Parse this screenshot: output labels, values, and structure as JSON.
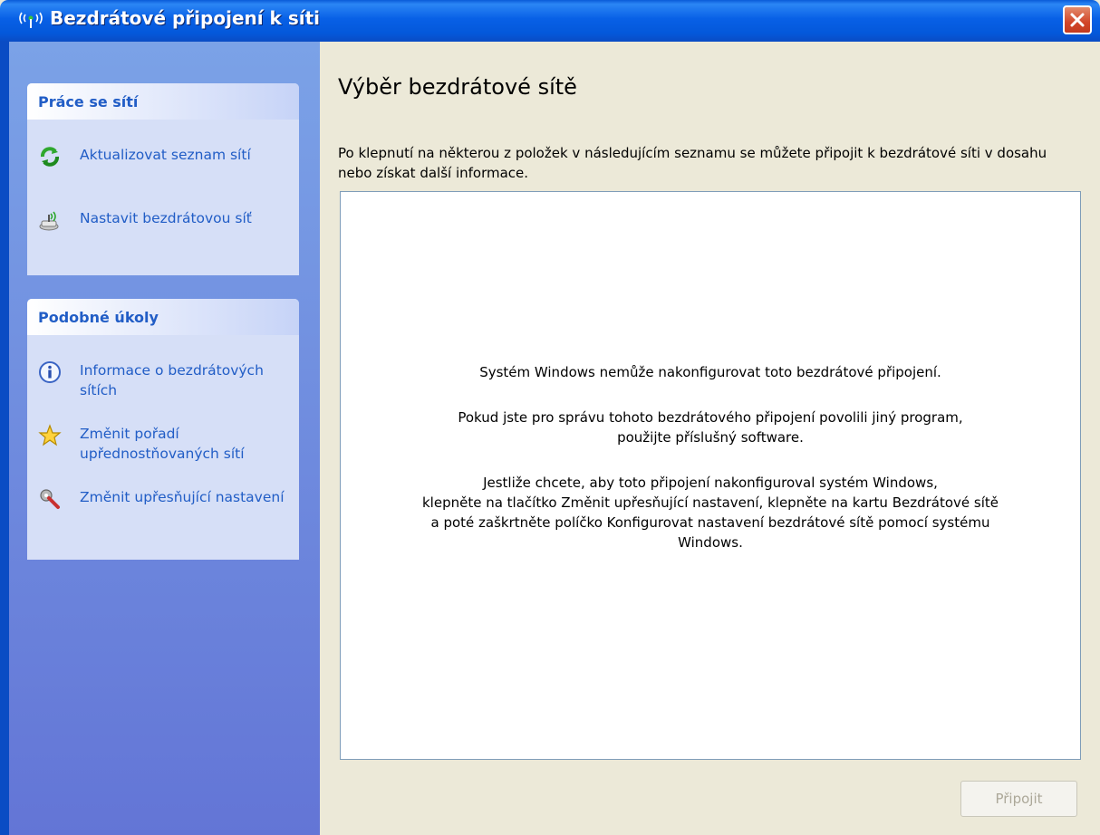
{
  "window": {
    "title": "Bezdrátové připojení k síti"
  },
  "sidebar": {
    "network_tasks": {
      "header": "Práce se sítí",
      "items": [
        {
          "label": "Aktualizovat seznam sítí",
          "icon": "refresh-icon"
        },
        {
          "label": "Nastavit bezdrátovou síť",
          "icon": "wireless-setup-icon"
        }
      ]
    },
    "related_tasks": {
      "header": "Podobné úkoly",
      "items": [
        {
          "label": "Informace o bezdrátových sítích",
          "icon": "info-icon"
        },
        {
          "label": "Změnit pořadí upřednostňovaných sítí",
          "icon": "star-icon"
        },
        {
          "label": "Změnit upřesňující nastavení",
          "icon": "tools-icon"
        }
      ]
    }
  },
  "main": {
    "heading": "Výběr bezdrátové sítě",
    "intro": "Po klepnutí na některou z položek v následujícím seznamu se můžete připojit k bezdrátové síti v dosahu nebo získat další informace.",
    "messages": {
      "line1": "Systém Windows nemůže nakonfigurovat toto bezdrátové připojení.",
      "line2": "Pokud jste pro správu tohoto bezdrátového připojení povolili jiný program,\npoužijte příslušný software.",
      "line3": "Jestliže chcete, aby toto připojení nakonfiguroval systém Windows,\nklepněte na tlačítko Změnit upřesňující nastavení, klepněte na kartu Bezdrátové sítě\na poté zaškrtněte políčko Konfigurovat nastavení bezdrátové sítě pomocí systému\nWindows."
    },
    "connect_label": "Připojit"
  },
  "colors": {
    "title_bar": "#0A5BD8",
    "sidebar": "#7BA2E7",
    "link": "#215DC6",
    "background": "#ECE9D8"
  }
}
